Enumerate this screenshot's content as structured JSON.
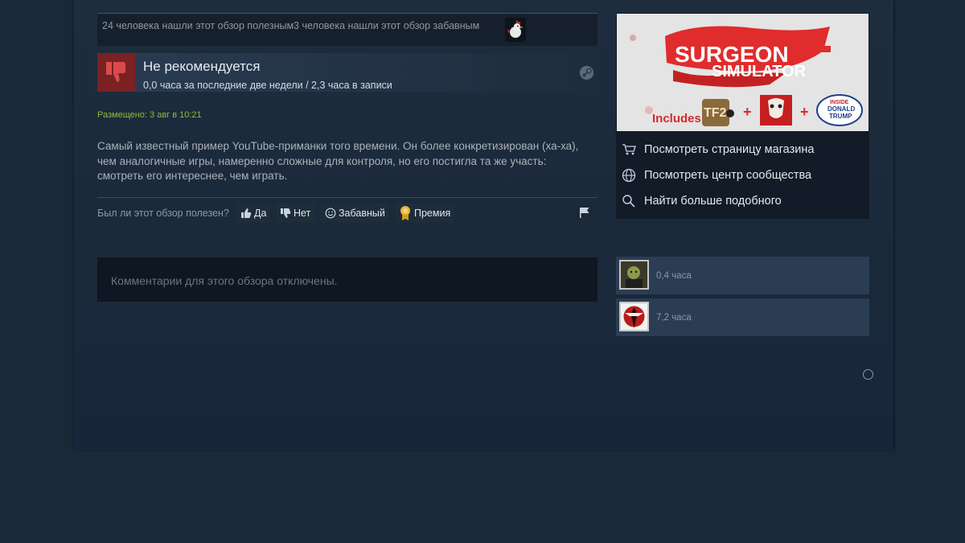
{
  "review": {
    "helpful_text": "24 человека нашли этот обзор полезным3 человека нашли этот обзор забавным",
    "verdict": "Не рекомендуется",
    "hours": "0,0 часа за последние две недели / 2,3 часа в записи",
    "posted": "Размещено: 3 авг в 10:21",
    "text": "Самый известный пример YouTube-приманки того времени. Он более конкретизирован (ха-ха), чем аналогичные игры, намеренно сложные для контроля, но его постигла та же участь: смотреть его интереснее, чем играть."
  },
  "vote": {
    "question": "Был ли этот обзор полезен?",
    "yes": "Да",
    "no": "Нет",
    "funny": "Забавный",
    "award": "Премия"
  },
  "comments": {
    "disabled": "Комментарии для этого обзора отключены."
  },
  "game": {
    "banner": {
      "title_line1": "SURGEON",
      "title_line2": "SIMULATOR",
      "includes": "Includes",
      "tf2": "TF2",
      "trump_line1": "INSIDE",
      "trump_line2": "DONALD",
      "trump_line3": "TRUMP"
    },
    "links": {
      "store": "Посмотреть страницу магазина",
      "community": "Посмотреть центр сообщества",
      "more": "Найти больше подобного"
    }
  },
  "players": [
    {
      "hours": "0,4 часа"
    },
    {
      "hours": "7,2 часа"
    }
  ],
  "colors": {
    "background": "#1b2838",
    "not_recommended": "#7b2124",
    "posted_green": "#8fb93b",
    "player_row": "#2a3d53"
  }
}
